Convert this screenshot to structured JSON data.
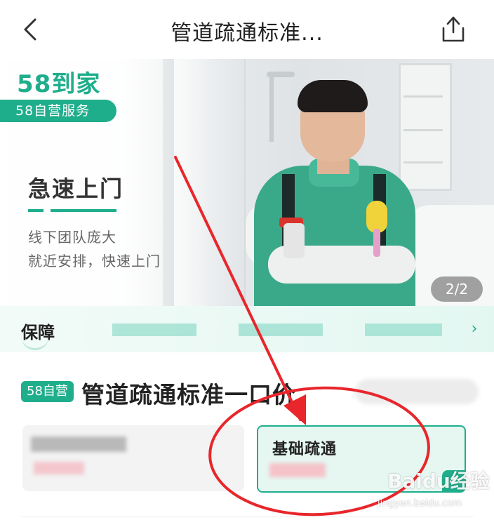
{
  "header": {
    "title": "管道疏通标准..."
  },
  "banner": {
    "logo_text": "58到家",
    "logo_sub": "58自营服务",
    "headline": "急速上门",
    "desc_line1": "线下团队庞大",
    "desc_line2": "就近安排，快速上门",
    "pager": "2/2"
  },
  "guarantee": {
    "label": "保障"
  },
  "product": {
    "tag": "58自营",
    "title": "管道疏通标准一口价",
    "options": [
      {
        "label": ""
      },
      {
        "label": "基础疏通",
        "selected": true
      }
    ]
  },
  "annotation": {
    "color": "#e8262b"
  },
  "watermark": {
    "brand": "Baidu经验",
    "url": "jingyan.baidu.com"
  },
  "colors": {
    "accent": "#1fae8c"
  }
}
